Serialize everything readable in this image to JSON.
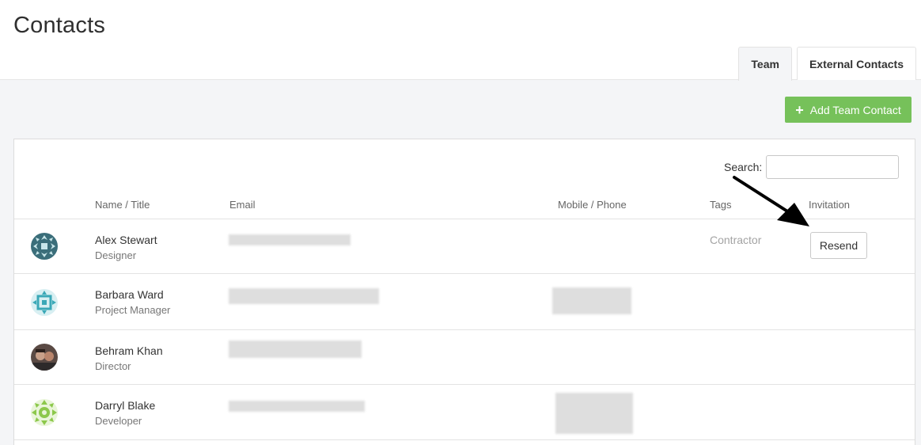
{
  "page": {
    "title": "Contacts"
  },
  "tabs": [
    {
      "label": "Team",
      "active": true
    },
    {
      "label": "External Contacts",
      "active": false
    }
  ],
  "actions": {
    "add_label": "Add Team Contact",
    "add_color": "#76c15a"
  },
  "search": {
    "label": "Search:",
    "placeholder": "",
    "value": ""
  },
  "table": {
    "columns": {
      "name": "Name / Title",
      "email": "Email",
      "phone": "Mobile / Phone",
      "tags": "Tags",
      "invitation": "Invitation"
    },
    "rows": [
      {
        "name": "Alex Stewart",
        "title": "Designer",
        "tag": "Contractor",
        "invitation": "Resend",
        "avatar": "pattern-avatar-teal-dark"
      },
      {
        "name": "Barbara Ward",
        "title": "Project Manager",
        "tag": "",
        "invitation": "",
        "avatar": "pattern-avatar-teal-light"
      },
      {
        "name": "Behram Khan",
        "title": "Director",
        "tag": "",
        "invitation": "",
        "avatar": "photo-avatar"
      },
      {
        "name": "Darryl Blake",
        "title": "Developer",
        "tag": "",
        "invitation": "",
        "avatar": "pattern-avatar-green"
      }
    ]
  },
  "annotation": {
    "icon": "arrow-pointer-icon"
  }
}
